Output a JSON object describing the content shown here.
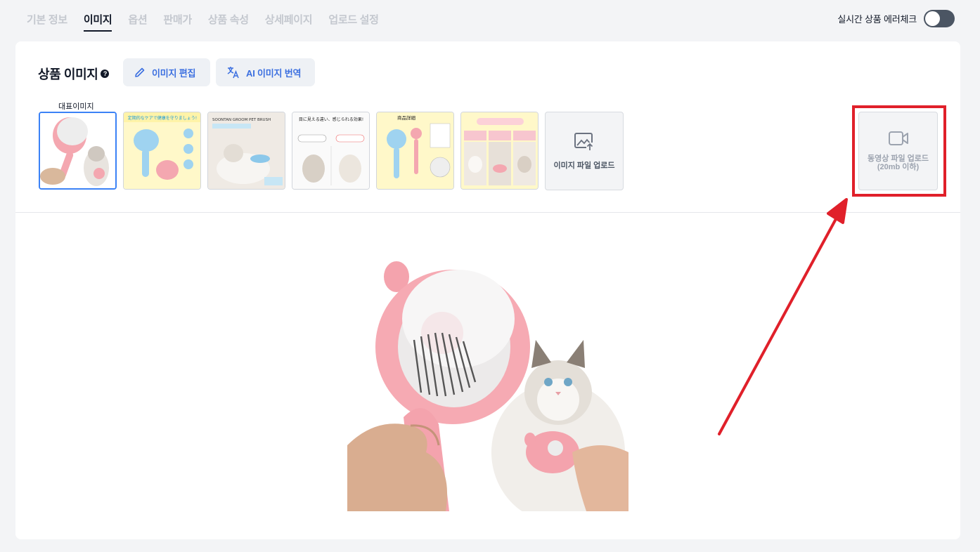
{
  "tabs": [
    {
      "label": "기본 정보",
      "active": false
    },
    {
      "label": "이미지",
      "active": true
    },
    {
      "label": "옵션",
      "active": false
    },
    {
      "label": "판매가",
      "active": false
    },
    {
      "label": "상품 속성",
      "active": false
    },
    {
      "label": "상세페이지",
      "active": false
    },
    {
      "label": "업로드 설정",
      "active": false
    }
  ],
  "toggle": {
    "label": "실시간 상품 에러체크",
    "on": false
  },
  "section": {
    "title": "상품 이미지",
    "help_icon": "question-circle-icon",
    "edit_button": "이미지 편집",
    "translate_button": "AI 이미지 번역"
  },
  "representative_label": "대표이미지",
  "thumbnails": [
    {
      "name": "thumb-1",
      "caption": ""
    },
    {
      "name": "thumb-2",
      "caption": "定期的なケアで健康を守りましょう!"
    },
    {
      "name": "thumb-3",
      "caption": "SOONTAN GROOM PET BRUSH"
    },
    {
      "name": "thumb-4",
      "caption": "目に見える違い、感じられる効果!"
    },
    {
      "name": "thumb-5",
      "caption": "商品詳細"
    },
    {
      "name": "thumb-6",
      "caption": ""
    }
  ],
  "upload_image_label": "이미지 파일 업로드",
  "upload_video_label_1": "동영상 파일 업로드",
  "upload_video_label_2": "(20mb 이하)",
  "colors": {
    "accent": "#3b6fe0",
    "highlight": "#e0202a",
    "selected": "#3b82f6"
  }
}
